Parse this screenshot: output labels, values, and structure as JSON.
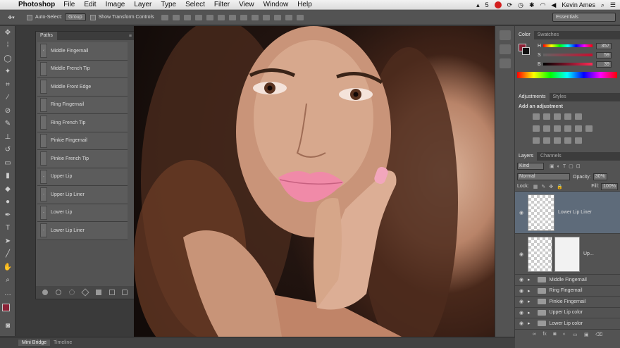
{
  "menubar": {
    "app": "Photoshop",
    "menus": [
      "File",
      "Edit",
      "Image",
      "Layer",
      "Type",
      "Select",
      "Filter",
      "View",
      "Window",
      "Help"
    ],
    "user": "Kevin Ames",
    "status_num": "5"
  },
  "options": {
    "auto_select": "Auto-Select:",
    "group": "Group",
    "show_transform": "Show Transform Controls",
    "workspace": "Essentials"
  },
  "paths_panel": {
    "title": "Paths",
    "items": [
      "Middle Fingernail",
      "Middle French Tip",
      "Middle Front Edge",
      "Ring Fingernail",
      "Ring French Tip",
      "Pinkie Fingernail",
      "Pinkie French Tip",
      "Upper Lip",
      "Upper Lip Liner",
      "Lower Lip",
      "Lower Lip Liner"
    ]
  },
  "color_panel": {
    "tabs": [
      "Color",
      "Swatches"
    ],
    "h_label": "H",
    "s_label": "S",
    "b_label": "B",
    "h": "357",
    "s": "59",
    "b": "39",
    "pct": "%"
  },
  "adjustments": {
    "tabs": [
      "Adjustments",
      "Styles"
    ],
    "title": "Add an adjustment"
  },
  "layers_panel": {
    "tabs": [
      "Layers",
      "Channels"
    ],
    "kind": "Kind",
    "blend": "Normal",
    "opacity_label": "Opacity:",
    "opacity": "30%",
    "lock_label": "Lock:",
    "fill_label": "Fill:",
    "fill": "100%",
    "selected_layer": "Lower Lip Liner",
    "second_layer": "Up...",
    "groups": [
      "Middle Fingernail",
      "Ring Fingernail",
      "Pinkie Fingernail",
      "Upper Lip color",
      "Lower Lip color"
    ]
  },
  "bottom": {
    "tabs": [
      "Mini Bridge",
      "Timeline"
    ]
  },
  "colors": {
    "foreground": "#8b2236",
    "selected_layer_bg": "#5e6b7a"
  }
}
